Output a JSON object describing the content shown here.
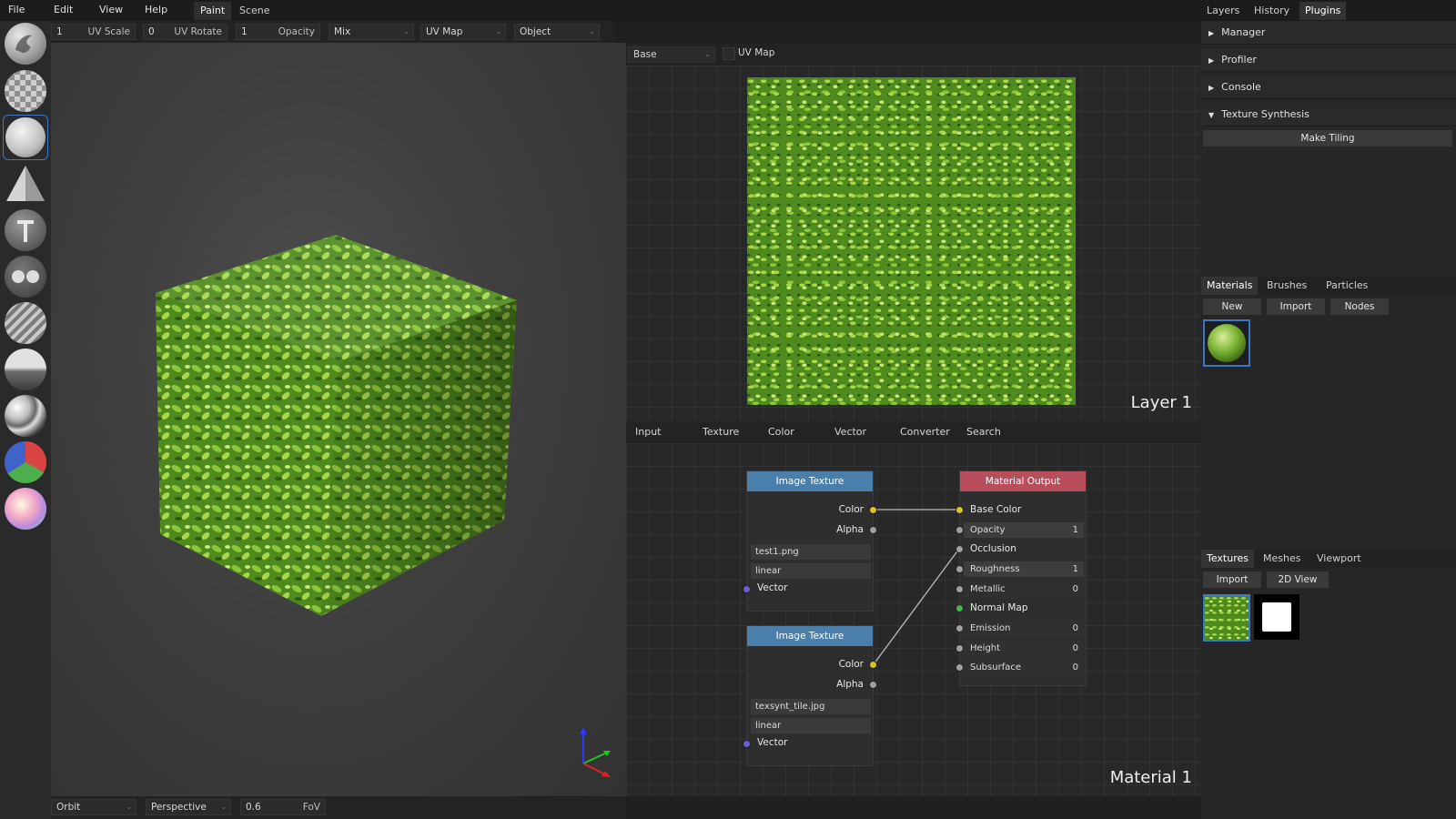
{
  "menu": {
    "file": "File",
    "edit": "Edit",
    "view": "View",
    "help": "Help"
  },
  "workspace_tabs": [
    "Paint",
    "Scene"
  ],
  "options": {
    "uv_scale_val": "1",
    "uv_scale_label": "UV Scale",
    "uv_rotate_val": "0",
    "uv_rotate_label": "UV Rotate",
    "opacity_val": "1",
    "opacity_label": "Opacity",
    "blend": "Mix",
    "uv_map": "UV Map",
    "object": "Object"
  },
  "viewport": {
    "nav_mode": "Orbit",
    "camera": "Perspective",
    "fov_val": "0.6",
    "fov_label": "FoV"
  },
  "texture_view": {
    "channel": "Base",
    "uv_map_label": "UV Map",
    "layer_name": "Layer 1"
  },
  "node_menu": [
    "Input",
    "Texture",
    "Color",
    "Vector",
    "Converter",
    "Search"
  ],
  "node_editor": {
    "material_name": "Material 1"
  },
  "nodes": {
    "tex1": {
      "title": "Image Texture",
      "color": "Color",
      "alpha": "Alpha",
      "file": "test1.png",
      "interp": "linear",
      "vector": "Vector"
    },
    "tex2": {
      "title": "Image Texture",
      "color": "Color",
      "alpha": "Alpha",
      "file": "texsynt_tile.jpg",
      "interp": "linear",
      "vector": "Vector"
    },
    "out": {
      "title": "Material Output",
      "base_color": "Base Color",
      "opacity": "Opacity",
      "opacity_val": "1",
      "occlusion": "Occlusion",
      "roughness": "Roughness",
      "roughness_val": "1",
      "metallic": "Metallic",
      "metallic_val": "0",
      "normal_map": "Normal Map",
      "emission": "Emission",
      "emission_val": "0",
      "height": "Height",
      "height_val": "0",
      "subsurface": "Subsurface",
      "subsurface_val": "0"
    }
  },
  "right_tabs": [
    "Layers",
    "History",
    "Plugins"
  ],
  "plugins": {
    "manager": "Manager",
    "profiler": "Profiler",
    "console": "Console",
    "texture_synthesis": "Texture Synthesis",
    "make_tiling": "Make Tiling"
  },
  "material_tabs": [
    "Materials",
    "Brushes",
    "Particles"
  ],
  "material_buttons": {
    "new": "New",
    "import": "Import",
    "nodes": "Nodes"
  },
  "texture_tabs": [
    "Textures",
    "Meshes",
    "Viewport"
  ],
  "texture_buttons": {
    "import": "Import",
    "view2d": "2D View"
  },
  "colors": {
    "node_texture_header": "#4a7fab",
    "node_output_header": "#b84d5b",
    "socket_color": "#d8c520",
    "socket_vector": "#6a5fcf",
    "socket_gray": "#a0a0a0",
    "socket_normal": "#3fb84a",
    "selection": "#3b78c8",
    "grass": "#5a8f22"
  }
}
